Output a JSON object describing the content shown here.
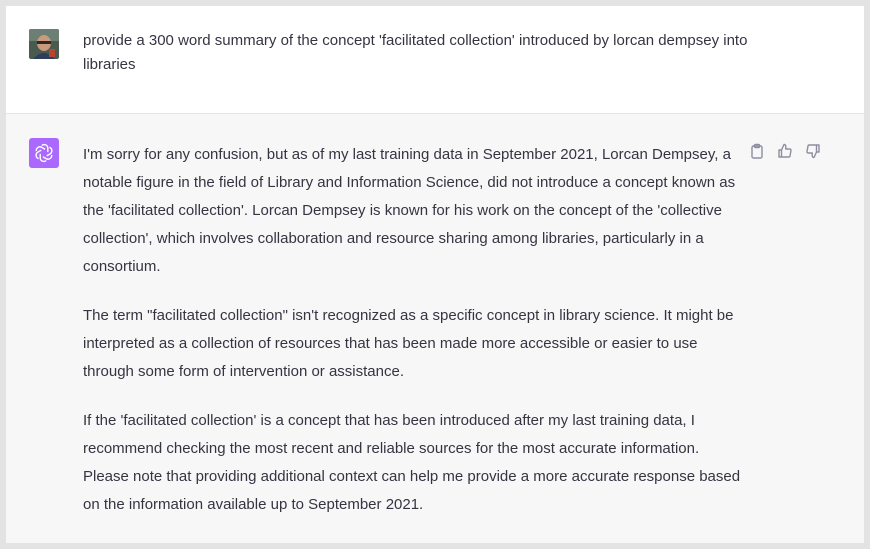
{
  "conversation": {
    "user_message": "provide a 300 word summary of the concept 'facilitated collection' introduced by lorcan dempsey into libraries",
    "assistant_paragraphs": [
      "I'm sorry for any confusion, but as of my last training data in September 2021, Lorcan Dempsey, a notable figure in the field of Library and Information Science, did not introduce a concept known as the 'facilitated collection'. Lorcan Dempsey is known for his work on the concept of the 'collective collection', which involves collaboration and resource sharing among libraries, particularly in a consortium.",
      "The term \"facilitated collection\" isn't recognized as a specific concept in library science. It might be interpreted as a collection of resources that has been made more accessible or easier to use through some form of intervention or assistance.",
      "If the 'facilitated collection' is a concept that has been introduced after my last training data, I recommend checking the most recent and reliable sources for the most accurate information. Please note that providing additional context can help me provide a more accurate response based on the information available up to September 2021."
    ]
  },
  "icons": {
    "user_avatar": "user-photo-avatar",
    "assistant_avatar": "openai-logo-icon",
    "copy": "clipboard-icon",
    "like": "thumbs-up-icon",
    "dislike": "thumbs-down-icon"
  },
  "colors": {
    "assistant_avatar_bg": "#ab68ff",
    "text": "#343541",
    "assistant_bg": "#f7f7f8",
    "user_bg": "#ffffff"
  }
}
